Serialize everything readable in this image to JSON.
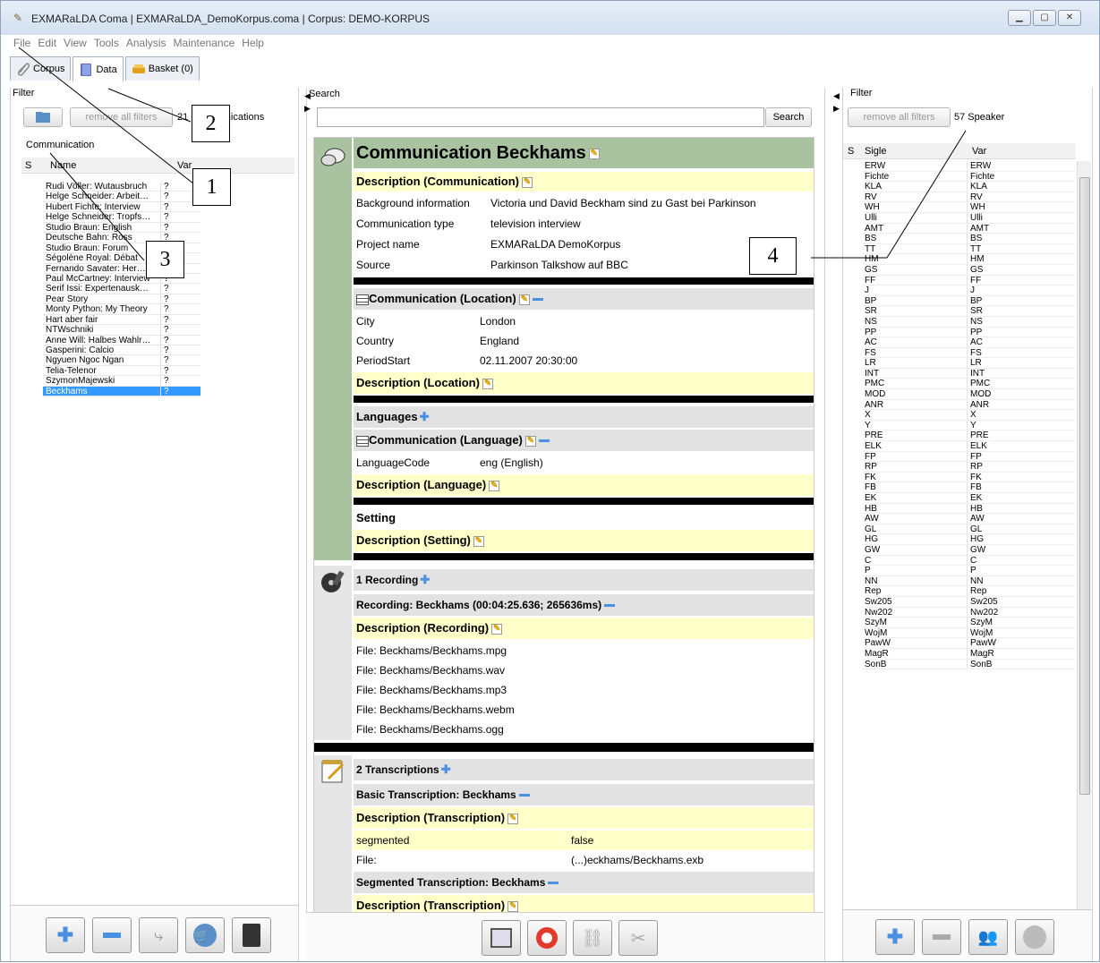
{
  "window": {
    "title": "EXMARaLDA Coma | EXMARaLDA_DemoKorpus.coma | Corpus: DEMO-KORPUS"
  },
  "menu": [
    "File",
    "Edit",
    "View",
    "Tools",
    "Analysis",
    "Maintenance",
    "Help"
  ],
  "tabs": [
    {
      "label": "Corpus"
    },
    {
      "label": "Data"
    },
    {
      "label": "Basket (0)"
    }
  ],
  "left": {
    "filter_label": "Filter",
    "remove_filters": "remove all filters",
    "count": "21 Communications",
    "section": "Communication",
    "col_s": "S",
    "col_name": "Name",
    "col_var": "Var",
    "rows": [
      [
        "Rudi Völler: Wutausbruch",
        "?"
      ],
      [
        "Helge Schneider: Arbeit…",
        "?"
      ],
      [
        "Hubert Fichte: Interview",
        "?"
      ],
      [
        "Helge Schneider: Tropfs…",
        "?"
      ],
      [
        "Studio Braun: English",
        "?"
      ],
      [
        "Deutsche Bahn: Ross",
        "?"
      ],
      [
        "Studio Braun: Forum",
        "?"
      ],
      [
        "Ségolène Royal: Débat",
        "?"
      ],
      [
        "Fernando Savater: Her…",
        "?"
      ],
      [
        "Paul McCartney: Interview",
        "?"
      ],
      [
        "Serif Issi: Expertenausk…",
        "?"
      ],
      [
        "Pear Story",
        "?"
      ],
      [
        "Monty Python: My Theory",
        "?"
      ],
      [
        "Hart aber fair",
        "?"
      ],
      [
        "NTWschniki",
        "?"
      ],
      [
        "Anne Will: Halbes Wahlr…",
        "?"
      ],
      [
        "Gasperini: Calcio",
        "?"
      ],
      [
        "Ngyuen Ngoc Ngan",
        "?"
      ],
      [
        "Telia-Telenor",
        "?"
      ],
      [
        "SzymonMajewski",
        "?"
      ],
      [
        "Beckhams",
        "?"
      ]
    ]
  },
  "center": {
    "search_label": "Search",
    "search_button": "Search",
    "title": "Communication Beckhams",
    "desc_comm": "Description (Communication)",
    "props": [
      [
        "Background information",
        "Victoria und David Beckham sind zu Gast bei Parkinson"
      ],
      [
        "Communication type",
        "television interview"
      ],
      [
        "Project name",
        "EXMARaLDA DemoKorpus"
      ],
      [
        "Source",
        "Parkinson Talkshow auf BBC"
      ]
    ],
    "loc_head": "Communication (Location)",
    "loc": [
      [
        "City",
        "London"
      ],
      [
        "Country",
        "England"
      ],
      [
        "PeriodStart",
        "02.11.2007 20:30:00"
      ]
    ],
    "desc_loc": "Description (Location)",
    "languages": "Languages",
    "lang_head": "Communication (Language)",
    "lang": [
      [
        "LanguageCode",
        "eng (English)"
      ]
    ],
    "desc_lang": "Description (Language)",
    "setting": "Setting",
    "desc_setting": "Description (Setting)",
    "rec_count": "1 Recording",
    "rec_head": "Recording: Beckhams (00:04:25.636; 265636ms)",
    "desc_rec": "Description (Recording)",
    "files": [
      "File: Beckhams/Beckhams.mpg",
      "File: Beckhams/Beckhams.wav",
      "File: Beckhams/Beckhams.mp3",
      "File: Beckhams/Beckhams.webm",
      "File: Beckhams/Beckhams.ogg"
    ],
    "trans_count": "2 Transcriptions",
    "basic_head": "Basic Transcription: Beckhams",
    "desc_trans": "Description (Transcription)",
    "trans_props": [
      [
        "segmented",
        "false"
      ],
      [
        "File:",
        "(...)eckhams/Beckhams.exb"
      ]
    ],
    "seg_head": "Segmented Transcription: Beckhams",
    "desc_trans2": "Description (Transcription)"
  },
  "right": {
    "filter_label": "Filter",
    "remove_filters": "remove all filters",
    "count": "57 Speaker",
    "col_s": "S",
    "col_sigle": "Sigle",
    "col_var": "Var",
    "rows": [
      [
        "ERW",
        "ERW"
      ],
      [
        "Fichte",
        "Fichte"
      ],
      [
        "KLA",
        "KLA"
      ],
      [
        "RV",
        "RV"
      ],
      [
        "WH",
        "WH"
      ],
      [
        "Ulli",
        "Ulli"
      ],
      [
        "AMT",
        "AMT"
      ],
      [
        "BS",
        "BS"
      ],
      [
        "TT",
        "TT"
      ],
      [
        "HM",
        "HM"
      ],
      [
        "GS",
        "GS"
      ],
      [
        "FF",
        "FF"
      ],
      [
        "J",
        "J"
      ],
      [
        "BP",
        "BP"
      ],
      [
        "SR",
        "SR"
      ],
      [
        "NS",
        "NS"
      ],
      [
        "PP",
        "PP"
      ],
      [
        "AC",
        "AC"
      ],
      [
        "FS",
        "FS"
      ],
      [
        "LR",
        "LR"
      ],
      [
        "INT",
        "INT"
      ],
      [
        "PMC",
        "PMC"
      ],
      [
        "MOD",
        "MOD"
      ],
      [
        "ANR",
        "ANR"
      ],
      [
        "X",
        "X"
      ],
      [
        "Y",
        "Y"
      ],
      [
        "PRE",
        "PRE"
      ],
      [
        "ELK",
        "ELK"
      ],
      [
        "FP",
        "FP"
      ],
      [
        "RP",
        "RP"
      ],
      [
        "FK",
        "FK"
      ],
      [
        "FB",
        "FB"
      ],
      [
        "EK",
        "EK"
      ],
      [
        "HB",
        "HB"
      ],
      [
        "AW",
        "AW"
      ],
      [
        "GL",
        "GL"
      ],
      [
        "HG",
        "HG"
      ],
      [
        "GW",
        "GW"
      ],
      [
        "C",
        "C"
      ],
      [
        "P",
        "P"
      ],
      [
        "NN",
        "NN"
      ],
      [
        "Rep",
        "Rep"
      ],
      [
        "Sw205",
        "Sw205"
      ],
      [
        "Nw202",
        "Nw202"
      ],
      [
        "SzyM",
        "SzyM"
      ],
      [
        "WojM",
        "WojM"
      ],
      [
        "PawW",
        "PawW"
      ],
      [
        "MagR",
        "MagR"
      ],
      [
        "SonB",
        "SonB"
      ]
    ]
  },
  "annotations": [
    "1",
    "2",
    "3",
    "4"
  ]
}
